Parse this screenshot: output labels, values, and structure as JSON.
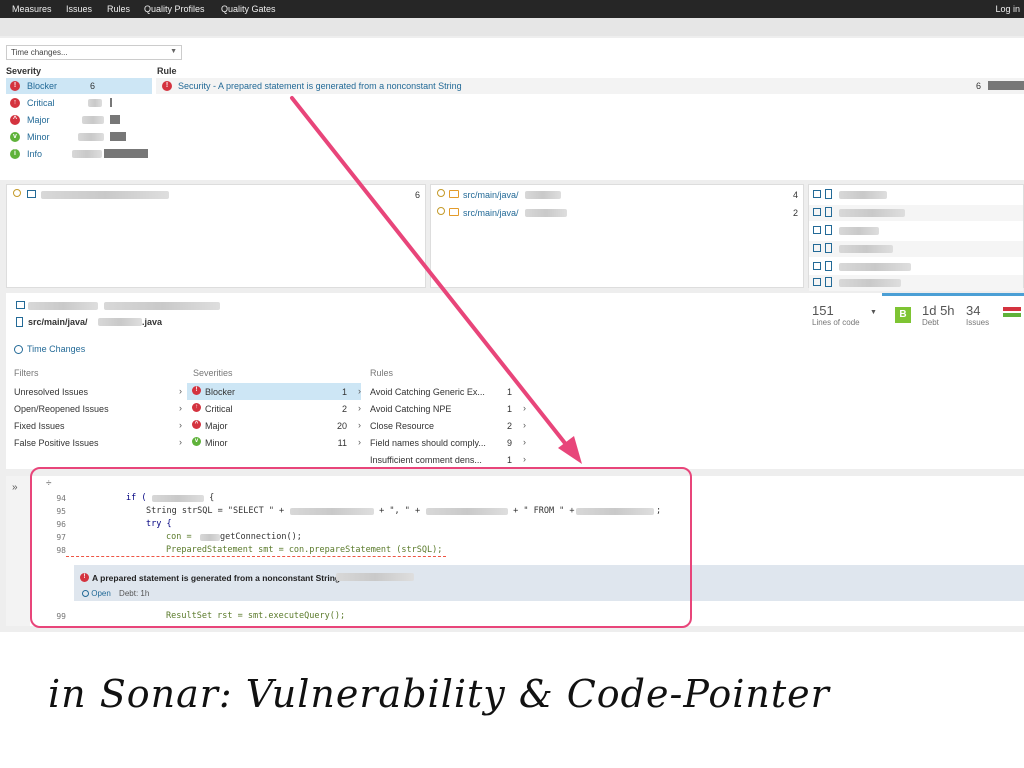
{
  "nav": {
    "items": [
      "Measures",
      "Issues",
      "Rules",
      "Quality Profiles",
      "Quality Gates"
    ],
    "login": "Log in"
  },
  "filter_select": {
    "value": "Time changes..."
  },
  "severity_panel": {
    "header": "Severity",
    "items": [
      {
        "label": "Blocker",
        "count": "6",
        "color": "#d4333f",
        "symbol": "!"
      },
      {
        "label": "Critical",
        "count": "",
        "color": "#d4333f",
        "symbol": "↑"
      },
      {
        "label": "Major",
        "count": "",
        "color": "#d4333f",
        "symbol": "^"
      },
      {
        "label": "Minor",
        "count": "",
        "color": "#5fb23a",
        "symbol": "v"
      },
      {
        "label": "Info",
        "count": "",
        "color": "#5fb23a",
        "symbol": "i"
      }
    ]
  },
  "rule_panel": {
    "header": "Rule",
    "rule": "Security - A prepared statement is generated from a nonconstant String",
    "count": "6"
  },
  "project_box": {
    "count": "6"
  },
  "dirs": [
    {
      "path": "src/main/java/",
      "count": "4"
    },
    {
      "path": "src/main/java/",
      "count": "2"
    }
  ],
  "file_header": {
    "path": "src/main/java/",
    "ext": ".java",
    "lines": "151",
    "lines_label": "Lines of code",
    "rating": "B",
    "debt": "1d 5h",
    "debt_label": "Debt",
    "issues": "34",
    "issues_label": "Issues"
  },
  "time_changes": "Time Changes",
  "filters": {
    "header": "Filters",
    "items": [
      "Unresolved Issues",
      "Open/Reopened Issues",
      "Fixed Issues",
      "False Positive Issues"
    ]
  },
  "severities": {
    "header": "Severities",
    "items": [
      {
        "label": "Blocker",
        "count": "1"
      },
      {
        "label": "Critical",
        "count": "2"
      },
      {
        "label": "Major",
        "count": "20"
      },
      {
        "label": "Minor",
        "count": "11"
      }
    ]
  },
  "rules": {
    "header": "Rules",
    "items": [
      {
        "label": "Avoid Catching Generic Ex...",
        "count": "1"
      },
      {
        "label": "Avoid Catching NPE",
        "count": "1"
      },
      {
        "label": "Close Resource",
        "count": "2"
      },
      {
        "label": "Field names should comply...",
        "count": "9"
      },
      {
        "label": "Insufficient comment dens...",
        "count": "1"
      }
    ]
  },
  "code": {
    "lines": [
      {
        "n": "94",
        "pre": "if (",
        "post": " {"
      },
      {
        "n": "95",
        "pre": "String strSQL = \"SELECT \" + ",
        "post": " + \", \" + ",
        "post2": " + \" FROM \" + ",
        "post3": ";"
      },
      {
        "n": "96",
        "pre": "try {"
      },
      {
        "n": "97",
        "pre": "con = ",
        "post": "getConnection();"
      },
      {
        "n": "98",
        "pre": "PreparedStatement smt = con.prepareStatement (strSQL);"
      },
      {
        "n": "99",
        "pre": "ResultSet rst = smt.executeQuery();"
      }
    ],
    "issue_message": "A prepared statement is generated from a nonconstant String in",
    "issue_status": "Open",
    "issue_debt": "Debt: 1h"
  },
  "caption": "in Sonar: Vulnerability & Code-Pointer"
}
